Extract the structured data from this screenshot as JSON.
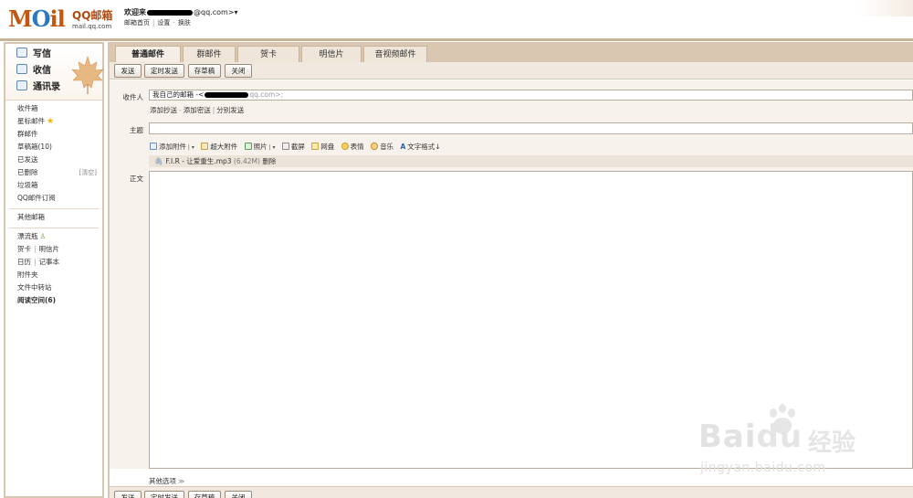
{
  "logo": {
    "moil_m": "M",
    "moil_o": "O",
    "moil_il": "il",
    "qq_text": "QQ邮箱",
    "url": "mail.qq.com"
  },
  "header": {
    "welcome_prefix": "欢迎来",
    "welcome_suffix": "@qq.com>▾",
    "links": [
      "邮箱首页",
      "设置",
      "换肤"
    ]
  },
  "sidebar": {
    "write": "写信",
    "receive": "收信",
    "contacts": "通讯录",
    "folders": {
      "inbox": "收件箱",
      "starred": "星标邮件",
      "group": "群邮件",
      "drafts": "草稿箱(10)",
      "sent": "已发送",
      "deleted": "已删除",
      "clean": "[清空]",
      "spam": "垃圾箱",
      "subscribe": "QQ邮件订阅",
      "other": "其他邮箱",
      "bottle": "漂流瓶",
      "card": "贺卡",
      "postcard": "明信片",
      "calendar": "日历",
      "notes": "记事本",
      "attachments": "附件夹",
      "transfer": "文件中转站",
      "reading": "阅读空间(6)"
    }
  },
  "tabs": [
    "普通邮件",
    "群邮件",
    "贺卡",
    "明信片",
    "音视频邮件"
  ],
  "toolbar": {
    "send": "发送",
    "timed": "定时发送",
    "draft": "存草稿",
    "close": "关闭"
  },
  "compose": {
    "to_label": "收件人",
    "to_value_prefix": "我自己的邮箱 -<",
    "to_value_suffix": "qq.com>;",
    "add_cc": "添加抄送",
    "add_bcc": "添加密送",
    "separate": "分别发送",
    "subject_label": "主题",
    "body_label": "正文",
    "attach_items": {
      "add_attachment": "添加附件",
      "big_attachment": "超大附件",
      "photo": "照片",
      "screenshot": "截屏",
      "netdisk": "网盘",
      "emoticon": "表情",
      "music": "音乐",
      "text_format": "文字格式↓"
    },
    "file_name": "F.I.R - 让爱重生.mp3",
    "file_size": "(6.42M)",
    "file_delete": "删除",
    "other_options": "其他选项"
  },
  "watermark": {
    "brand_bai": "Bai",
    "brand_du": "du",
    "brand_cn": "经验",
    "sub": "jingyan.baidu.com"
  },
  "colors": {
    "accent": "#c2570f",
    "tab_bg": "#d9c7b1",
    "border": "#d7c6b1"
  }
}
